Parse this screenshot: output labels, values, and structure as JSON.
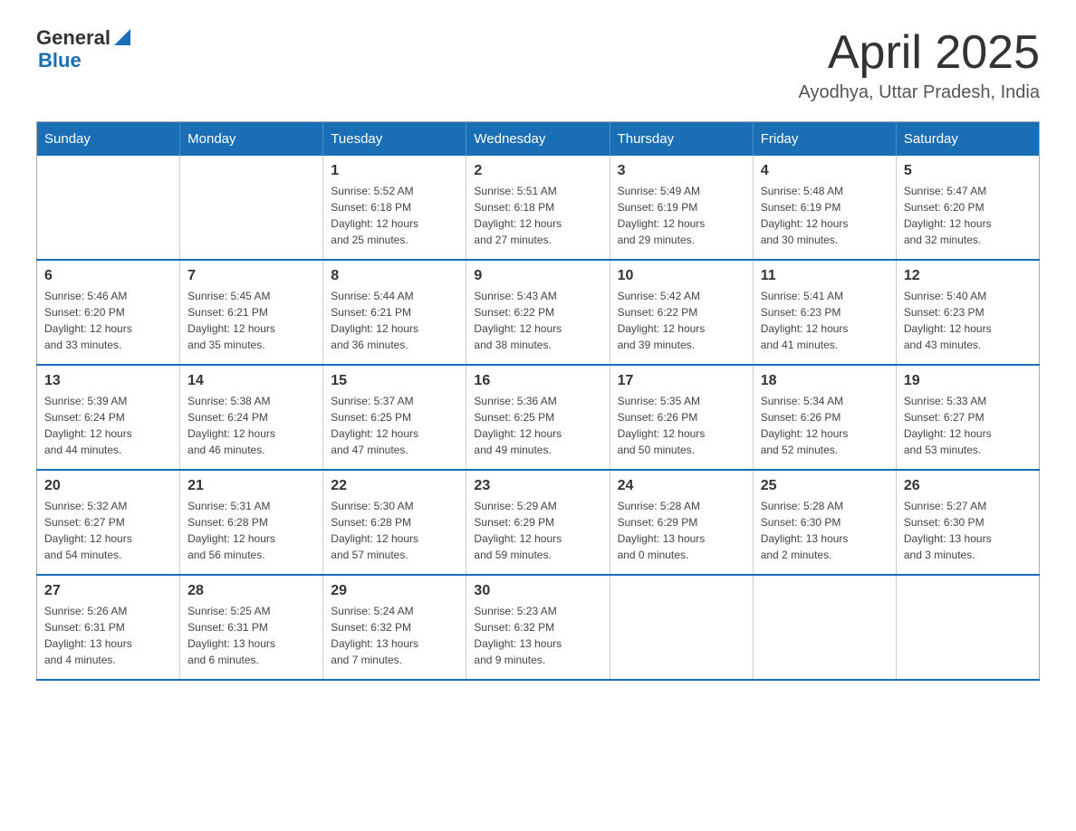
{
  "header": {
    "logo_general": "General",
    "logo_blue": "Blue",
    "month_title": "April 2025",
    "location": "Ayodhya, Uttar Pradesh, India"
  },
  "weekdays": [
    "Sunday",
    "Monday",
    "Tuesday",
    "Wednesday",
    "Thursday",
    "Friday",
    "Saturday"
  ],
  "weeks": [
    [
      {
        "day": "",
        "info": ""
      },
      {
        "day": "",
        "info": ""
      },
      {
        "day": "1",
        "info": "Sunrise: 5:52 AM\nSunset: 6:18 PM\nDaylight: 12 hours\nand 25 minutes."
      },
      {
        "day": "2",
        "info": "Sunrise: 5:51 AM\nSunset: 6:18 PM\nDaylight: 12 hours\nand 27 minutes."
      },
      {
        "day": "3",
        "info": "Sunrise: 5:49 AM\nSunset: 6:19 PM\nDaylight: 12 hours\nand 29 minutes."
      },
      {
        "day": "4",
        "info": "Sunrise: 5:48 AM\nSunset: 6:19 PM\nDaylight: 12 hours\nand 30 minutes."
      },
      {
        "day": "5",
        "info": "Sunrise: 5:47 AM\nSunset: 6:20 PM\nDaylight: 12 hours\nand 32 minutes."
      }
    ],
    [
      {
        "day": "6",
        "info": "Sunrise: 5:46 AM\nSunset: 6:20 PM\nDaylight: 12 hours\nand 33 minutes."
      },
      {
        "day": "7",
        "info": "Sunrise: 5:45 AM\nSunset: 6:21 PM\nDaylight: 12 hours\nand 35 minutes."
      },
      {
        "day": "8",
        "info": "Sunrise: 5:44 AM\nSunset: 6:21 PM\nDaylight: 12 hours\nand 36 minutes."
      },
      {
        "day": "9",
        "info": "Sunrise: 5:43 AM\nSunset: 6:22 PM\nDaylight: 12 hours\nand 38 minutes."
      },
      {
        "day": "10",
        "info": "Sunrise: 5:42 AM\nSunset: 6:22 PM\nDaylight: 12 hours\nand 39 minutes."
      },
      {
        "day": "11",
        "info": "Sunrise: 5:41 AM\nSunset: 6:23 PM\nDaylight: 12 hours\nand 41 minutes."
      },
      {
        "day": "12",
        "info": "Sunrise: 5:40 AM\nSunset: 6:23 PM\nDaylight: 12 hours\nand 43 minutes."
      }
    ],
    [
      {
        "day": "13",
        "info": "Sunrise: 5:39 AM\nSunset: 6:24 PM\nDaylight: 12 hours\nand 44 minutes."
      },
      {
        "day": "14",
        "info": "Sunrise: 5:38 AM\nSunset: 6:24 PM\nDaylight: 12 hours\nand 46 minutes."
      },
      {
        "day": "15",
        "info": "Sunrise: 5:37 AM\nSunset: 6:25 PM\nDaylight: 12 hours\nand 47 minutes."
      },
      {
        "day": "16",
        "info": "Sunrise: 5:36 AM\nSunset: 6:25 PM\nDaylight: 12 hours\nand 49 minutes."
      },
      {
        "day": "17",
        "info": "Sunrise: 5:35 AM\nSunset: 6:26 PM\nDaylight: 12 hours\nand 50 minutes."
      },
      {
        "day": "18",
        "info": "Sunrise: 5:34 AM\nSunset: 6:26 PM\nDaylight: 12 hours\nand 52 minutes."
      },
      {
        "day": "19",
        "info": "Sunrise: 5:33 AM\nSunset: 6:27 PM\nDaylight: 12 hours\nand 53 minutes."
      }
    ],
    [
      {
        "day": "20",
        "info": "Sunrise: 5:32 AM\nSunset: 6:27 PM\nDaylight: 12 hours\nand 54 minutes."
      },
      {
        "day": "21",
        "info": "Sunrise: 5:31 AM\nSunset: 6:28 PM\nDaylight: 12 hours\nand 56 minutes."
      },
      {
        "day": "22",
        "info": "Sunrise: 5:30 AM\nSunset: 6:28 PM\nDaylight: 12 hours\nand 57 minutes."
      },
      {
        "day": "23",
        "info": "Sunrise: 5:29 AM\nSunset: 6:29 PM\nDaylight: 12 hours\nand 59 minutes."
      },
      {
        "day": "24",
        "info": "Sunrise: 5:28 AM\nSunset: 6:29 PM\nDaylight: 13 hours\nand 0 minutes."
      },
      {
        "day": "25",
        "info": "Sunrise: 5:28 AM\nSunset: 6:30 PM\nDaylight: 13 hours\nand 2 minutes."
      },
      {
        "day": "26",
        "info": "Sunrise: 5:27 AM\nSunset: 6:30 PM\nDaylight: 13 hours\nand 3 minutes."
      }
    ],
    [
      {
        "day": "27",
        "info": "Sunrise: 5:26 AM\nSunset: 6:31 PM\nDaylight: 13 hours\nand 4 minutes."
      },
      {
        "day": "28",
        "info": "Sunrise: 5:25 AM\nSunset: 6:31 PM\nDaylight: 13 hours\nand 6 minutes."
      },
      {
        "day": "29",
        "info": "Sunrise: 5:24 AM\nSunset: 6:32 PM\nDaylight: 13 hours\nand 7 minutes."
      },
      {
        "day": "30",
        "info": "Sunrise: 5:23 AM\nSunset: 6:32 PM\nDaylight: 13 hours\nand 9 minutes."
      },
      {
        "day": "",
        "info": ""
      },
      {
        "day": "",
        "info": ""
      },
      {
        "day": "",
        "info": ""
      }
    ]
  ]
}
